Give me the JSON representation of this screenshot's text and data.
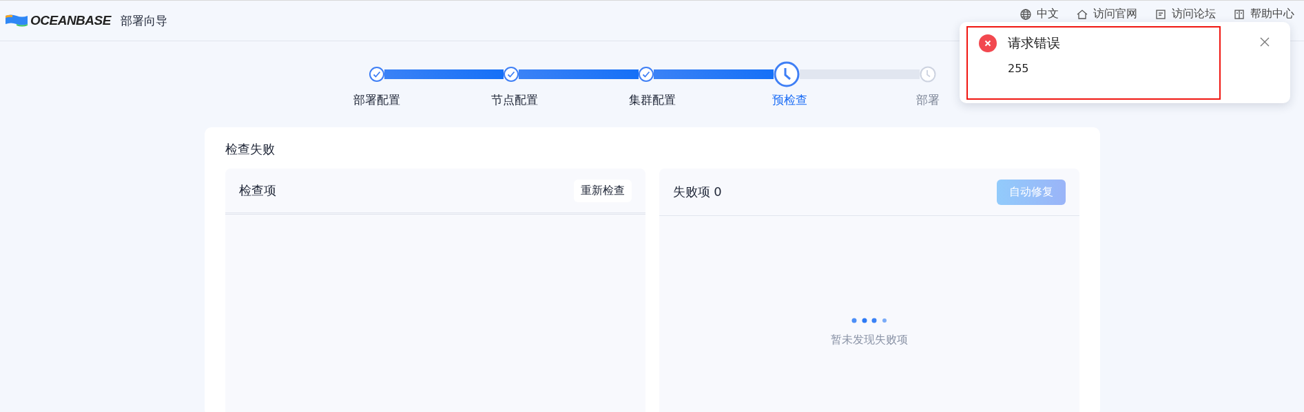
{
  "header": {
    "logo_text": "OCEANBASE",
    "title": "部署向导",
    "nav": [
      {
        "label": "中文"
      },
      {
        "label": "访问官网"
      },
      {
        "label": "访问论坛"
      },
      {
        "label": "帮助中心"
      }
    ]
  },
  "steps": [
    {
      "label": "部署配置",
      "kind": "done"
    },
    {
      "label": "节点配置",
      "kind": "done"
    },
    {
      "label": "集群配置",
      "kind": "done"
    },
    {
      "label": "预检查",
      "kind": "active"
    },
    {
      "label": "部署",
      "kind": "waiting"
    }
  ],
  "card": {
    "title": "检查失败",
    "left_panel": {
      "title": "检查项",
      "button": "重新检查"
    },
    "right_panel": {
      "title": "失败项 0",
      "button": {
        "label": "自动修复",
        "disabled": true
      },
      "empty_text": "暂未发现失败项"
    }
  },
  "notification": {
    "title": "请求错误",
    "message": "255"
  }
}
